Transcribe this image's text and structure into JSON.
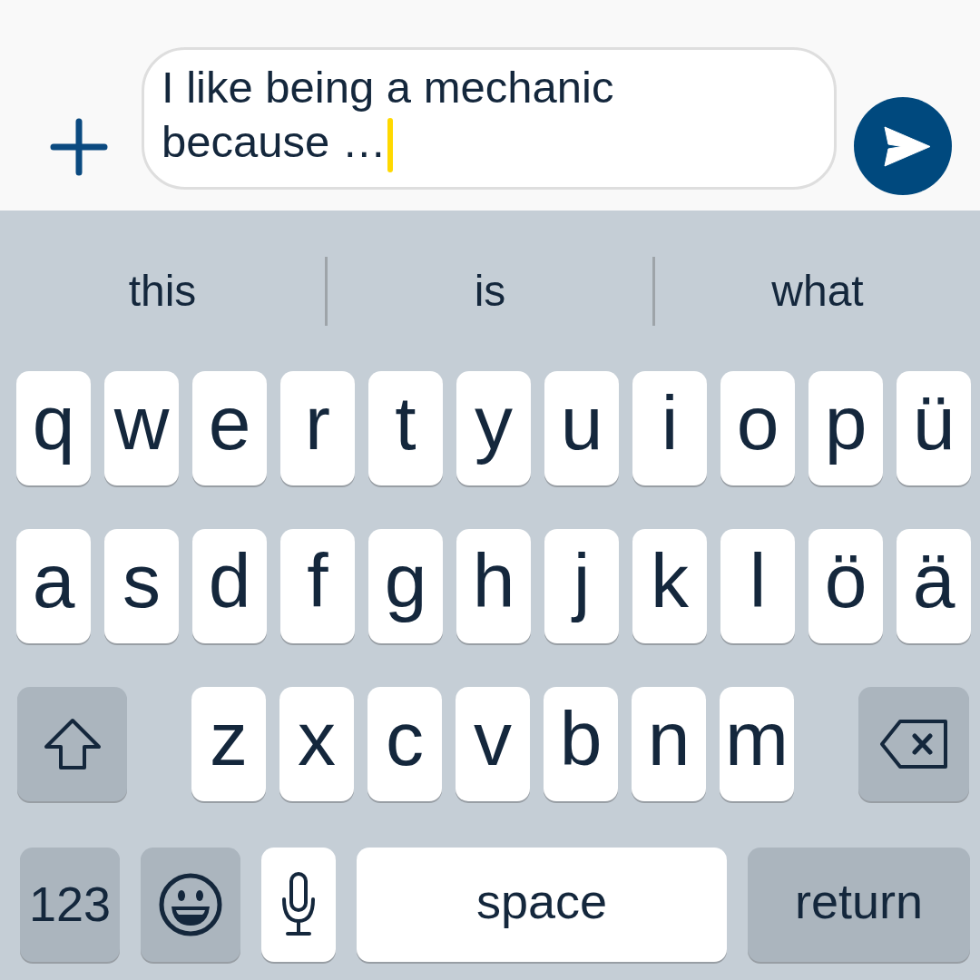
{
  "composer": {
    "message": "I like being a mechanic because …"
  },
  "suggestions": [
    "this",
    "is",
    "what"
  ],
  "keyboard": {
    "top_row": [
      {
        "kind": "letter",
        "label": "q"
      },
      {
        "kind": "letter",
        "label": "w"
      },
      {
        "kind": "letter",
        "label": "e"
      },
      {
        "kind": "letter",
        "label": "r"
      },
      {
        "kind": "letter",
        "label": "t"
      },
      {
        "kind": "letter",
        "label": "y"
      },
      {
        "kind": "letter",
        "label": "u"
      },
      {
        "kind": "letter",
        "label": "i"
      },
      {
        "kind": "letter",
        "label": "o"
      },
      {
        "kind": "letter",
        "label": "p"
      },
      {
        "kind": "letter",
        "label": "ü"
      }
    ],
    "home_row": [
      {
        "kind": "letter",
        "label": "a"
      },
      {
        "kind": "letter",
        "label": "s"
      },
      {
        "kind": "letter",
        "label": "d"
      },
      {
        "kind": "letter",
        "label": "f"
      },
      {
        "kind": "letter",
        "label": "g"
      },
      {
        "kind": "letter",
        "label": "h"
      },
      {
        "kind": "letter",
        "label": "j"
      },
      {
        "kind": "letter",
        "label": "k"
      },
      {
        "kind": "letter",
        "label": "l"
      },
      {
        "kind": "letter",
        "label": "ö"
      },
      {
        "kind": "letter",
        "label": "ä"
      }
    ],
    "bottom_row": [
      {
        "kind": "shift"
      },
      {
        "kind": "letter",
        "label": "z"
      },
      {
        "kind": "letter",
        "label": "x"
      },
      {
        "kind": "letter",
        "label": "c"
      },
      {
        "kind": "letter",
        "label": "v"
      },
      {
        "kind": "letter",
        "label": "b"
      },
      {
        "kind": "letter",
        "label": "n"
      },
      {
        "kind": "letter",
        "label": "m"
      },
      {
        "kind": "delete"
      }
    ],
    "space_row": [
      {
        "kind": "mode",
        "label": "123"
      },
      {
        "kind": "emoji"
      },
      {
        "kind": "dictation"
      },
      {
        "kind": "space",
        "label": "space"
      },
      {
        "kind": "return",
        "label": "return"
      }
    ]
  }
}
